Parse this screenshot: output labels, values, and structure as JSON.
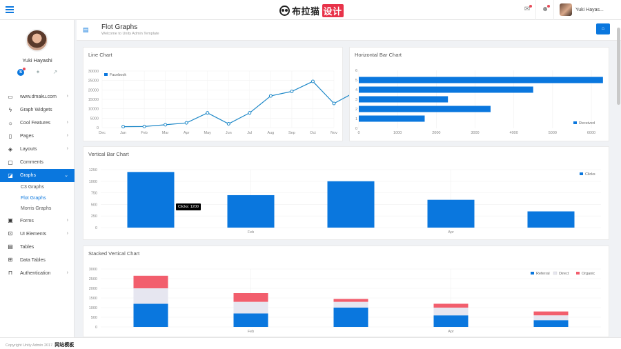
{
  "topbar": {
    "logo_text": "布拉猫",
    "logo_red": "设计",
    "user_name": "Yuki Hayas..."
  },
  "sidebar": {
    "profile_name": "Yuki Hayashi",
    "profile_icons": [
      "skype-icon",
      "twitter-icon",
      "share-icon"
    ],
    "menu": [
      {
        "label": "www.dmaku.com",
        "icon": "monitor-icon",
        "chevron": true
      },
      {
        "label": "Graph Widgets",
        "icon": "zap-icon",
        "chevron": false
      },
      {
        "label": "Cool Features",
        "icon": "sun-icon",
        "chevron": true
      },
      {
        "label": "Pages",
        "icon": "file-icon",
        "chevron": true
      },
      {
        "label": "Layouts",
        "icon": "layers-icon",
        "chevron": true
      },
      {
        "label": "Comments",
        "icon": "message-icon",
        "chevron": false
      },
      {
        "label": "Graphs",
        "icon": "chart-icon",
        "chevron": true,
        "active": true
      }
    ],
    "submenu": [
      {
        "label": "C3 Graphs"
      },
      {
        "label": "Flot Graphs",
        "current": true
      },
      {
        "label": "Morris Graphs"
      }
    ],
    "menu2": [
      {
        "label": "Forms",
        "icon": "grid-icon",
        "chevron": true
      },
      {
        "label": "UI Elements",
        "icon": "box-icon",
        "chevron": true
      },
      {
        "label": "Tables",
        "icon": "table-icon",
        "chevron": false
      },
      {
        "label": "Data Tables",
        "icon": "data-table-icon",
        "chevron": false
      },
      {
        "label": "Authentication",
        "icon": "lock-icon",
        "chevron": true
      }
    ]
  },
  "page": {
    "title": "Flot Graphs",
    "subtitle": "Welcome to Unity Admin Template"
  },
  "footer": {
    "copyright": "Copyright Unity Admin 2017.",
    "brand": "网站模板"
  },
  "colors": {
    "accent": "#0a77de",
    "stack_direct": "#e6e6f0",
    "stack_organic": "#f25e6d"
  },
  "chart_data": [
    {
      "type": "line",
      "title": "Line Chart",
      "x": [
        "Dec",
        "Jan",
        "Feb",
        "Mar",
        "Apr",
        "May",
        "Jun",
        "Jul",
        "Aug",
        "Sep",
        "Oct",
        "Nov"
      ],
      "series": [
        {
          "name": "Facebook",
          "values": [
            null,
            500,
            600,
            1500,
            2500,
            7800,
            2000,
            7800,
            16800,
            19200,
            24500,
            12800,
            18800
          ]
        }
      ],
      "ylim": [
        0,
        30000
      ],
      "yticks": [
        "30000",
        "25000",
        "20000",
        "15000",
        "10000",
        "5000",
        "0"
      ],
      "legend": "top-left"
    },
    {
      "type": "bar",
      "orientation": "horizontal",
      "title": "Horizontal Bar Chart",
      "categories": [
        "1",
        "2",
        "3",
        "4",
        "5"
      ],
      "series": [
        {
          "name": "Received",
          "values": [
            1700,
            3400,
            2300,
            4500,
            6300
          ]
        }
      ],
      "xticks": [
        "0",
        "1000",
        "2000",
        "3000",
        "4000",
        "5000",
        "6000"
      ],
      "yticks": [
        "6",
        "5",
        "4",
        "3",
        "2",
        "1",
        "0"
      ],
      "xlim": [
        0,
        6000
      ],
      "legend": "bottom-right"
    },
    {
      "type": "bar",
      "title": "Vertical Bar Chart",
      "categories": [
        "",
        "Feb",
        "",
        "Apr",
        ""
      ],
      "series": [
        {
          "name": "Clicks",
          "values": [
            1200,
            700,
            1000,
            600,
            350
          ]
        }
      ],
      "yticks": [
        "1250",
        "1000",
        "750",
        "500",
        "250",
        "0"
      ],
      "ylim": [
        0,
        1250
      ],
      "legend": "top-right",
      "tooltip": "Clicks: 1200"
    },
    {
      "type": "bar",
      "stacked": true,
      "title": "Stacked Vertical Chart",
      "categories": [
        "",
        "Feb",
        "",
        "Apr",
        ""
      ],
      "series": [
        {
          "name": "Referral",
          "values": [
            1200,
            700,
            1000,
            600,
            350
          ]
        },
        {
          "name": "Direct",
          "values": [
            800,
            600,
            300,
            400,
            250
          ]
        },
        {
          "name": "Organic",
          "values": [
            650,
            450,
            150,
            200,
            200
          ]
        }
      ],
      "yticks": [
        "3000",
        "2500",
        "2000",
        "1500",
        "1000",
        "500",
        "0"
      ],
      "ylim": [
        0,
        3000
      ],
      "legend": "top-right"
    }
  ]
}
